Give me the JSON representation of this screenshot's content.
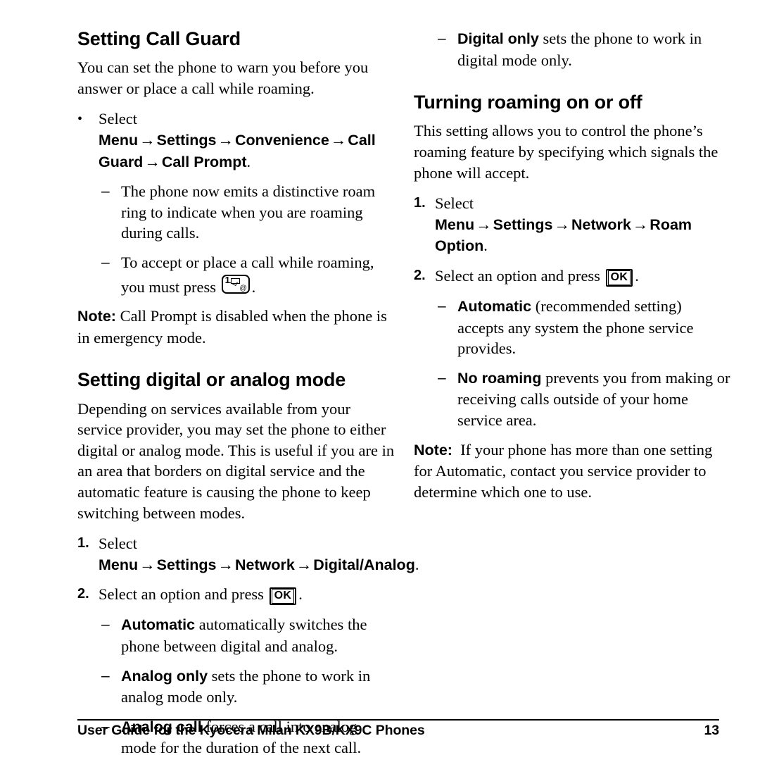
{
  "document": {
    "footer_text": "User Guide for the Kyocera Milan KX9B/KX9C Phones",
    "page_number": "13"
  },
  "arrow": "→",
  "bullet": "•",
  "dash": "–",
  "keys": {
    "ok_label": "OK",
    "one_label": "1",
    "at_label": "@"
  },
  "left_column": {
    "heading_1": "Setting Call Guard",
    "intro_1": "You can set the phone to warn you before you answer or place a call while roaming.",
    "bullet_1": {
      "marker": "•",
      "lead": "Select ",
      "path": [
        "Menu",
        "Settings",
        "Convenience",
        "Call Guard",
        "Call Prompt"
      ],
      "tail": "."
    },
    "sub_1": "The phone now emits a distinctive roam ring to indicate when you are roaming during calls.",
    "sub_2_before": "To accept or place a call while roaming, you must press ",
    "sub_2_after": ".",
    "note_1_label": "Note:",
    "note_1_text": "Call Prompt is disabled when the phone is in emergency mode.",
    "heading_2": "Setting digital or analog mode",
    "intro_2": "Depending on services available from your service provider, you may set the phone to either digital or analog mode. This is useful if you are in an area that borders on digital service and the automatic feature is causing the phone to keep switching between modes.",
    "step_1": {
      "marker": "1.",
      "lead": "Select ",
      "path": [
        "Menu",
        "Settings",
        "Network",
        "Digital/Analog"
      ],
      "tail": "."
    },
    "step_2": {
      "marker": "2.",
      "before": "Select an option and press ",
      "after": "."
    },
    "options": [
      {
        "term": "Automatic",
        "desc": " automatically switches the phone between digital and analog."
      },
      {
        "term": "Analog only",
        "desc": " sets the phone to work in analog mode only."
      },
      {
        "term": "Analog call",
        "desc": " forces a call into analog mode for the duration of the next call."
      }
    ]
  },
  "right_column": {
    "option_carry": {
      "term": "Digital only",
      "desc": " sets the phone to work in digital mode only."
    },
    "heading_1": "Turning roaming on or off",
    "intro_1": "This setting allows you to control the phone’s roaming feature by specifying which signals the phone will accept.",
    "step_1": {
      "marker": "1.",
      "lead": "Select ",
      "path": [
        "Menu",
        "Settings",
        "Network",
        "Roam Option"
      ],
      "tail": "."
    },
    "step_2": {
      "marker": "2.",
      "before": "Select an option and press ",
      "after": "."
    },
    "options": [
      {
        "term": "Automatic",
        "desc": " (recommended setting) accepts any system the phone service provides."
      },
      {
        "term": "No roaming",
        "desc": " prevents you from making or receiving calls outside of your home service area."
      }
    ],
    "note_label": "Note:",
    "note_text": "If your phone has more than one setting for Automatic, contact you service provider to determine which one to use."
  }
}
